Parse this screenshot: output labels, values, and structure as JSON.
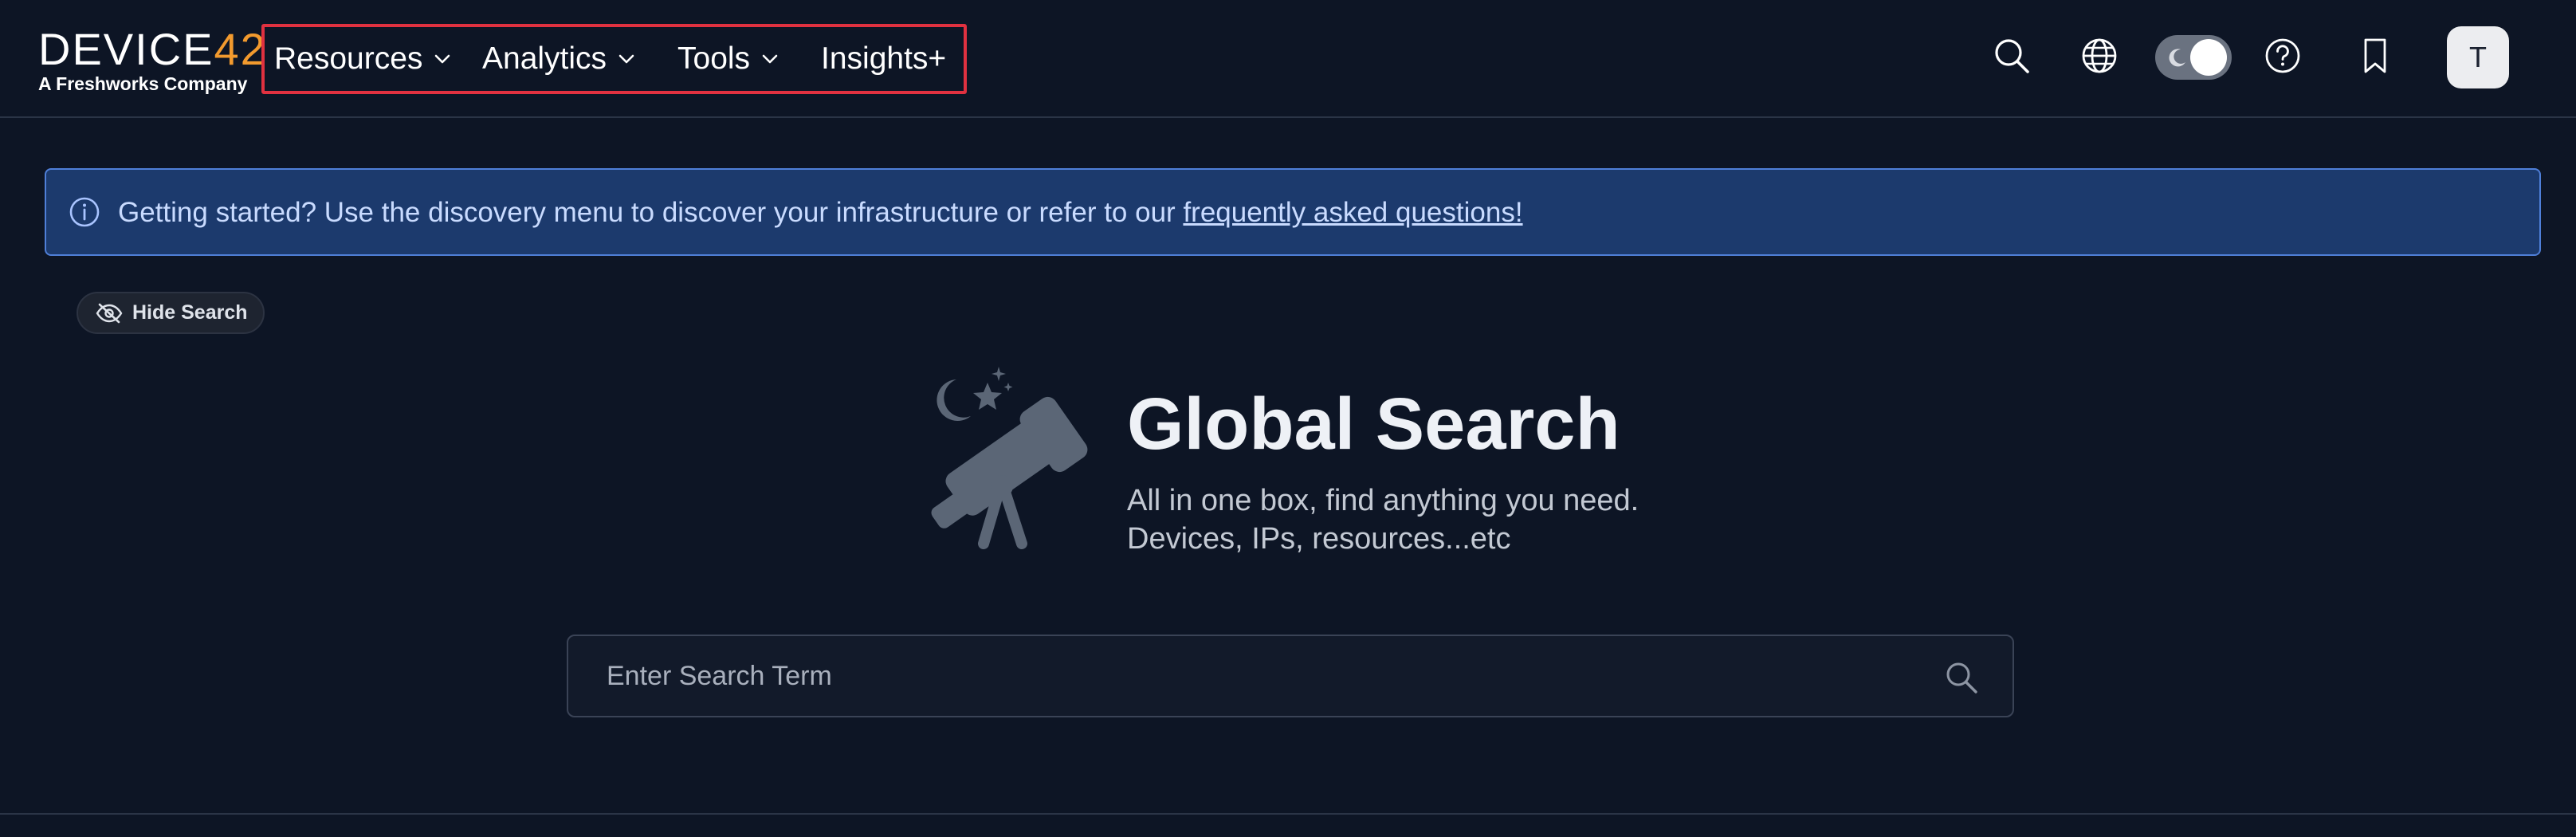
{
  "brand": {
    "name_prefix": "DEVICE",
    "name_number": "42",
    "tagline": "A Freshworks Company",
    "accent_color": "#f29a2e"
  },
  "nav": {
    "items": [
      {
        "label": "Resources",
        "has_dropdown": true
      },
      {
        "label": "Analytics",
        "has_dropdown": true
      },
      {
        "label": "Tools",
        "has_dropdown": true
      },
      {
        "label": "Insights+",
        "has_dropdown": false
      }
    ],
    "highlight_color": "#e03140"
  },
  "header_icons": [
    "search-icon",
    "globe-icon",
    "theme-toggle",
    "help-icon",
    "bookmark-icon"
  ],
  "user": {
    "avatar_initial": "T"
  },
  "banner": {
    "text": "Getting started? Use the discovery menu to discover your infrastructure or refer to our ",
    "link_text": "frequently asked questions!",
    "icon": "info-icon",
    "background_color": "#1c3a6d"
  },
  "hide_search": {
    "label": "Hide Search",
    "icon": "eye-slash-icon"
  },
  "hero": {
    "title": "Global Search",
    "subtitle_line1": "All in one box, find anything you need.",
    "subtitle_line2": "Devices, IPs, resources...etc",
    "illustration": "telescope-icon"
  },
  "search": {
    "placeholder": "Enter Search Term",
    "value": ""
  }
}
